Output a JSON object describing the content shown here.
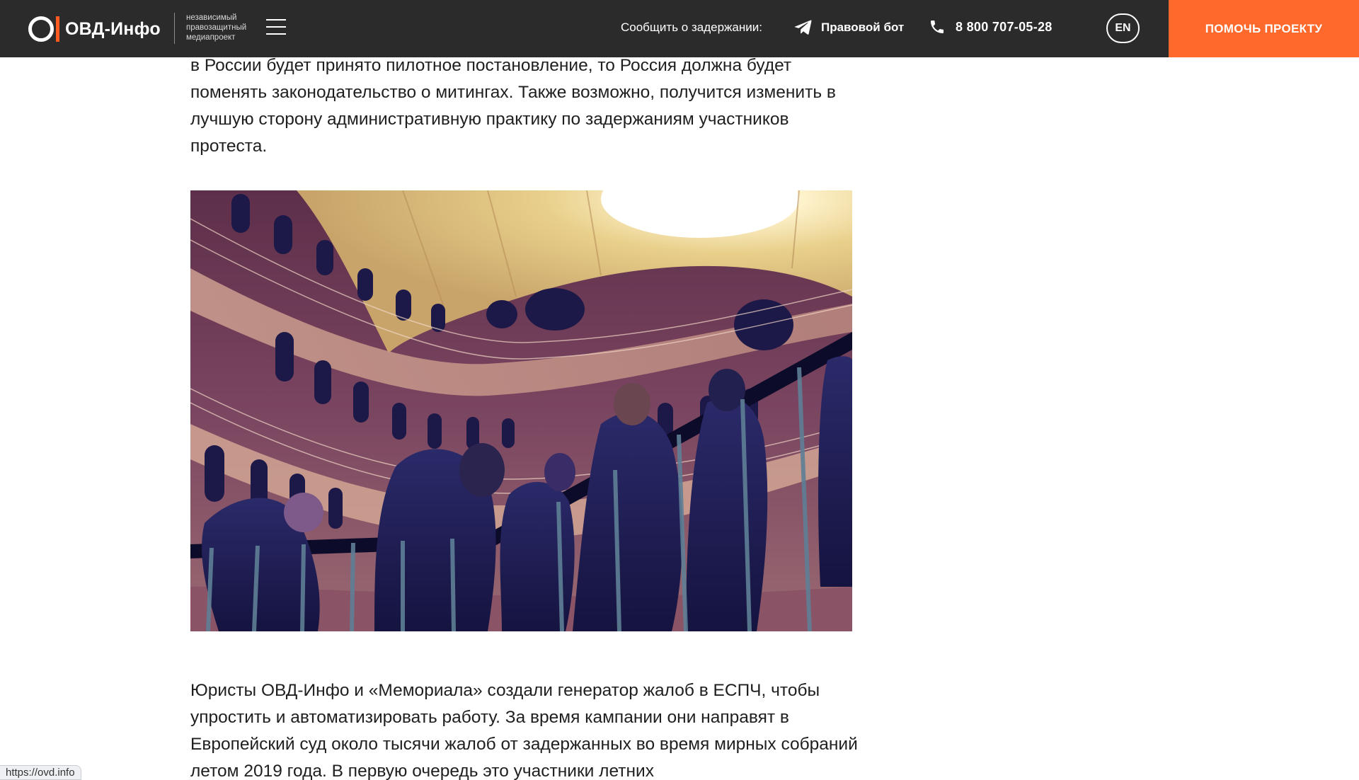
{
  "header": {
    "logo_text": "ОВД-Инфо",
    "tagline": [
      "независимый",
      "правозащитный",
      "медиапроект"
    ],
    "report_label": "Сообщить о задержании:",
    "bot_label": "Правовой бот",
    "phone": "8 800 707-05-28",
    "lang_button": "EN",
    "donate_button": "ПОМОЧЬ ПРОЕКТУ",
    "icons": [
      "menu-icon",
      "telegram-icon",
      "phone-icon"
    ],
    "colors": {
      "header_bg": "#2b2b2b",
      "accent": "#ff6a2c"
    }
  },
  "article": {
    "paragraph_1": "в России будет принято пилотное постановление, то Россия должна будет поменять законодательство о митингах. Также возможно, получится изменить в лучшую сторону административную практику по задержаниям участников протеста.",
    "illustration": "prison-rotunda-illustration",
    "paragraph_2": "Юристы ОВД-Инфо и «Мемориала» создали генератор жалоб в ЕСПЧ, чтобы упростить и автоматизировать работу. За время кампании они направят в Европейский суд около тысячи жалоб от задержанных во время мирных собраний летом 2019 года. В первую очередь это участники летних"
  },
  "status_bar": {
    "url": "https://ovd.info"
  }
}
